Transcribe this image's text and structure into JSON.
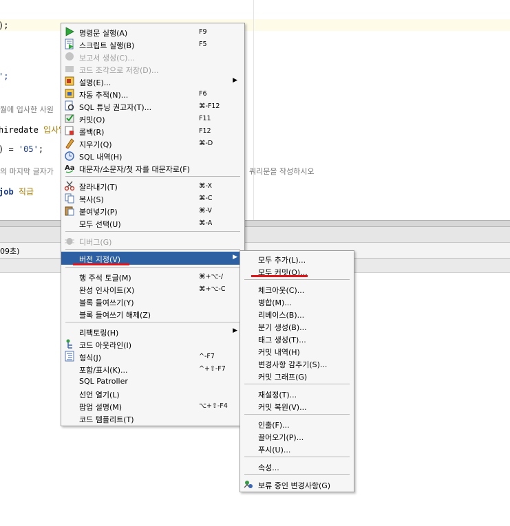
{
  "editor": {
    "lines": [
      {
        "a": ");"
      },
      {
        "a": "';"
      },
      {
        "c": "월에 입사한 사원"
      },
      {
        "a": "hiredate",
        "h": "입사일"
      },
      {
        "a": ") = ",
        "s": "'05'",
        "t": ";"
      },
      {
        "c": "의 마지막 글자가"
      },
      {
        "c2": "쿼리문을 작성하시오"
      },
      {
        "a": "job",
        "h": "직급"
      }
    ]
  },
  "status": {
    "text": "09초)"
  },
  "main_menu": {
    "items": [
      {
        "label": "명령문 실행(A)",
        "shortcut": "F9",
        "icon": "run-statement-icon"
      },
      {
        "label": "스크립트 실행(B)",
        "shortcut": "F5",
        "icon": "run-script-icon"
      },
      {
        "label": "보고서 생성(C)...",
        "icon": "report-icon"
      },
      {
        "label": "코드 조각으로 저장(D)...",
        "icon": "snippet-icon"
      },
      {
        "label": "설명(E)...",
        "icon": "explain-icon"
      },
      {
        "label": "자동 추적(N)...",
        "shortcut": "F6",
        "icon": "autotrace-icon"
      },
      {
        "label": "SQL 튜닝 권고자(T)...",
        "shortcut": "⌘-F12",
        "icon": "sql-tuning-icon"
      },
      {
        "label": "커밋(O)",
        "shortcut": "F11",
        "icon": "commit-icon"
      },
      {
        "label": "롤백(R)",
        "shortcut": "F12",
        "icon": "rollback-icon"
      },
      {
        "label": "지우기(Q)",
        "shortcut": "⌘-D",
        "icon": "clear-icon"
      },
      {
        "label": "SQL 내역(H)",
        "icon": "sql-history-icon"
      },
      {
        "label": "대문자/소문자/첫 자를 대문자로(F)",
        "icon": "case-icon"
      },
      {
        "label": "잘라내기(T)",
        "shortcut": "⌘-X",
        "icon": "cut-icon"
      },
      {
        "label": "복사(S)",
        "shortcut": "⌘-C",
        "icon": "copy-icon"
      },
      {
        "label": "붙여넣기(P)",
        "shortcut": "⌘-V",
        "icon": "paste-icon"
      },
      {
        "label": "모두 선택(U)",
        "shortcut": "⌘-A"
      },
      {
        "label": "디버그(G)",
        "icon": "debug-icon"
      },
      {
        "label": "버전 지정(V)"
      },
      {
        "label": "행 주석 토글(M)",
        "shortcut": "⌘+⌥-/"
      },
      {
        "label": "완성 인사이트(X)",
        "shortcut": "⌘+⌥-C"
      },
      {
        "label": "블록 들여쓰기(Y)"
      },
      {
        "label": "블록 들여쓰기 해제(Z)"
      },
      {
        "label": "리팩토링(H)"
      },
      {
        "label": "코드 아웃라인(I)",
        "icon": "outline-icon"
      },
      {
        "label": "형식(J)",
        "shortcut": "^-F7",
        "icon": "format-icon"
      },
      {
        "label": "포함/표시(K)...",
        "shortcut": "^+⇧-F7"
      },
      {
        "label": "SQL Patroller"
      },
      {
        "label": "선언 열기(L)"
      },
      {
        "label": "팝업 설명(M)",
        "shortcut": "⌥+⇧-F4"
      },
      {
        "label": "코드 템플리트(T)"
      }
    ]
  },
  "submenu": {
    "items": [
      {
        "label": "모두 추가(L)..."
      },
      {
        "label": "모두 커밋(O)..."
      },
      {
        "label": "체크아웃(C)..."
      },
      {
        "label": "병합(M)..."
      },
      {
        "label": "리베이스(B)..."
      },
      {
        "label": "분기 생성(B)..."
      },
      {
        "label": "태그 생성(T)..."
      },
      {
        "label": "커밋 내역(H)"
      },
      {
        "label": "변경사항 감추기(S)..."
      },
      {
        "label": "커밋 그래프(G)"
      },
      {
        "label": "재설정(T)..."
      },
      {
        "label": "커밋 복원(V)..."
      },
      {
        "label": "인출(F)..."
      },
      {
        "label": "끌어오기(P)..."
      },
      {
        "label": "푸시(U)..."
      },
      {
        "label": "속성..."
      },
      {
        "label": "보류 중인 변경사항(G)",
        "icon": "pending-changes-icon"
      }
    ]
  },
  "colors": {
    "selection": "#2d5fa3",
    "underline": "#e0161a",
    "menu_bg": "#f6f6f6"
  }
}
